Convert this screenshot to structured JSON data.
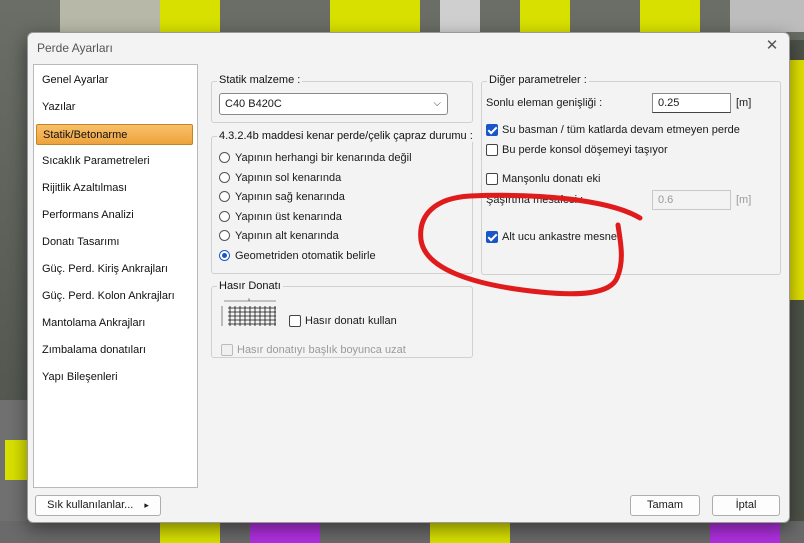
{
  "window_title": "Perde Ayarları",
  "sidebar": {
    "items": [
      {
        "label": "Genel Ayarlar"
      },
      {
        "label": "Yazılar"
      },
      {
        "label": "Statik/Betonarme",
        "selected": true
      },
      {
        "label": "Sıcaklık Parametreleri"
      },
      {
        "label": "Rijitlik Azaltılması"
      },
      {
        "label": "Performans Analizi"
      },
      {
        "label": "Donatı Tasarımı"
      },
      {
        "label": "Güç. Perd. Kiriş Ankrajları"
      },
      {
        "label": "Güç. Perd. Kolon Ankrajları"
      },
      {
        "label": "Mantolama Ankrajları"
      },
      {
        "label": "Zımbalama donatıları"
      },
      {
        "label": "Yapı Bileşenleri"
      }
    ]
  },
  "static_material": {
    "label": "Statik malzeme :",
    "value": "C40 B420C"
  },
  "edge_group": {
    "label": "4.3.2.4b maddesi kenar perde/çelik çapraz durumu :",
    "options": [
      {
        "label": "Yapının herhangi bir kenarında değil",
        "checked": false
      },
      {
        "label": "Yapının sol kenarında",
        "checked": false
      },
      {
        "label": "Yapının sağ kenarında",
        "checked": false
      },
      {
        "label": "Yapının üst kenarında",
        "checked": false
      },
      {
        "label": "Yapının alt kenarında",
        "checked": false
      },
      {
        "label": "Geometriden otomatik belirle",
        "checked": true
      }
    ]
  },
  "mesh_group": {
    "label": "Hasır Donatı",
    "use_mesh_label": "Hasır donatı kullan",
    "along_head_label": "Hasır donatıyı başlık boyunca uzat"
  },
  "other_params": {
    "label": "Diğer parametreler :",
    "fe_width_label": "Sonlu eleman genişliği :",
    "fe_width_value": "0.25",
    "fe_width_unit": "[m]",
    "su_basman_label": "Su basman / tüm katlarda devam etmeyen perde",
    "konsol_label": "Bu perde konsol döşemeyi taşıyor",
    "mansonlu_label": "Manşonlu donatı eki",
    "spacing_label": "Şaşırtma mesafesi :",
    "spacing_value": "0.6",
    "spacing_unit": "[m]",
    "alt_ucu_label": "Alt ucu ankastre mesnet"
  },
  "footer": {
    "favorites_label": "Sık kullanılanlar...",
    "ok_label": "Tamam",
    "cancel_label": "İptal"
  },
  "colors": {
    "accent": "#1a56c9",
    "selected_item": "#eda33c",
    "annotation": "#e01b1b"
  }
}
